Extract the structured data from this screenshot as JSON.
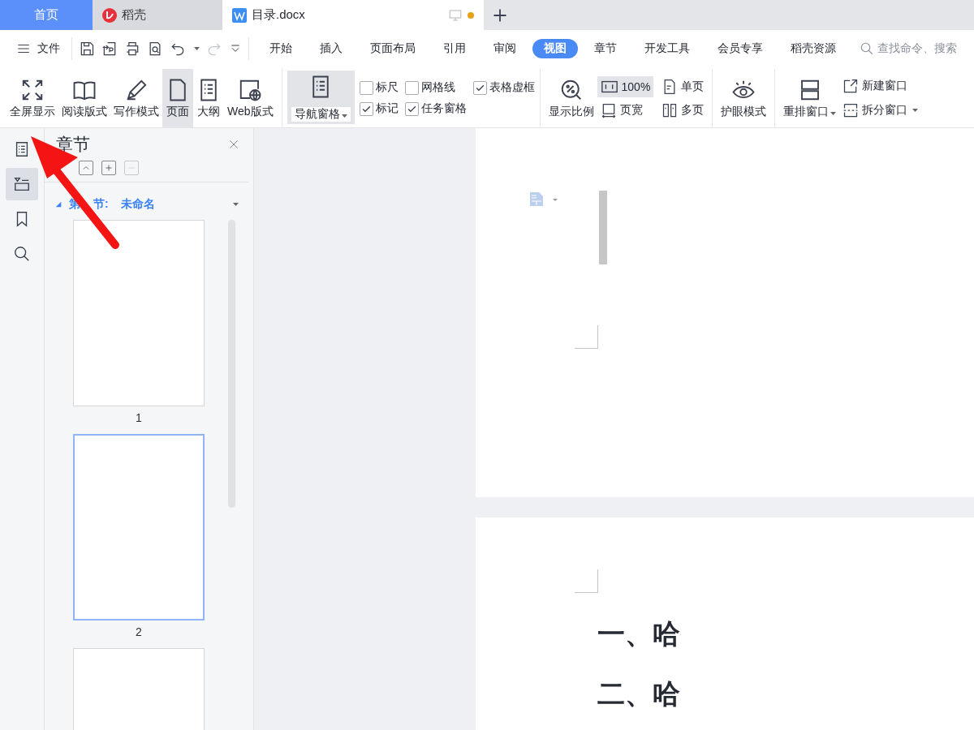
{
  "tabs": [
    {
      "label": "首页",
      "kind": "home",
      "selected": false
    },
    {
      "label": "稻壳",
      "kind": "app",
      "selected": false
    },
    {
      "label": "目录.docx",
      "kind": "doc",
      "selected": true,
      "unsaved": true
    }
  ],
  "menu": {
    "file": "文件",
    "tabs": [
      {
        "label": "开始",
        "selected": false
      },
      {
        "label": "插入",
        "selected": false
      },
      {
        "label": "页面布局",
        "selected": false
      },
      {
        "label": "引用",
        "selected": false
      },
      {
        "label": "审阅",
        "selected": false
      },
      {
        "label": "视图",
        "selected": true
      },
      {
        "label": "章节",
        "selected": false
      },
      {
        "label": "开发工具",
        "selected": false
      },
      {
        "label": "会员专享",
        "selected": false
      },
      {
        "label": "稻壳资源",
        "selected": false
      }
    ],
    "search": {
      "placeholder": "查找命令、搜索"
    }
  },
  "ribbon": {
    "view_modes": [
      {
        "label": "全屏显示",
        "kind": "fullscreen",
        "selected": false
      },
      {
        "label": "阅读版式",
        "kind": "book",
        "selected": false
      },
      {
        "label": "写作模式",
        "kind": "pen",
        "selected": false
      },
      {
        "label": "页面",
        "kind": "page",
        "selected": true
      },
      {
        "label": "大纲",
        "kind": "outline",
        "selected": false
      },
      {
        "label": "Web版式",
        "kind": "web",
        "selected": false
      }
    ],
    "nav_pane": {
      "label": "导航窗格",
      "selected": true
    },
    "options": [
      {
        "label": "标尺",
        "checked": false
      },
      {
        "label": "网格线",
        "checked": false
      },
      {
        "label": "表格虚框",
        "checked": true
      },
      {
        "label": "标记",
        "checked": true
      },
      {
        "label": "任务窗格",
        "checked": true
      }
    ],
    "zoom": {
      "label": "显示比例"
    },
    "zoom_options": [
      {
        "label": "100%",
        "kind": "ratio",
        "selected": true
      },
      {
        "label": "单页",
        "kind": "single",
        "selected": false
      },
      {
        "label": "页宽",
        "kind": "width",
        "selected": false
      },
      {
        "label": "多页",
        "kind": "multi",
        "selected": false
      }
    ],
    "eye": {
      "label": "护眼模式"
    },
    "arrange": {
      "label": "重排窗口"
    },
    "windows": [
      {
        "label": "新建窗口",
        "kind": "new"
      },
      {
        "label": "拆分窗口",
        "kind": "split"
      }
    ]
  },
  "rail": [
    {
      "kind": "outline",
      "selected": false
    },
    {
      "kind": "nav",
      "selected": true
    },
    {
      "kind": "bookmark",
      "selected": false
    },
    {
      "kind": "search",
      "selected": false
    }
  ],
  "panel": {
    "title": "章节",
    "section": {
      "title": "第 节: 未命名",
      "expanded": true
    },
    "thumbnails": [
      {
        "label": "1",
        "selected": false
      },
      {
        "label": "2",
        "selected": true
      },
      {
        "selected": false
      }
    ]
  },
  "document": {
    "pages": [
      {
        "kind": "blank"
      },
      {
        "kind": "text",
        "headings": [
          "一、哈",
          "二、哈"
        ]
      }
    ]
  }
}
